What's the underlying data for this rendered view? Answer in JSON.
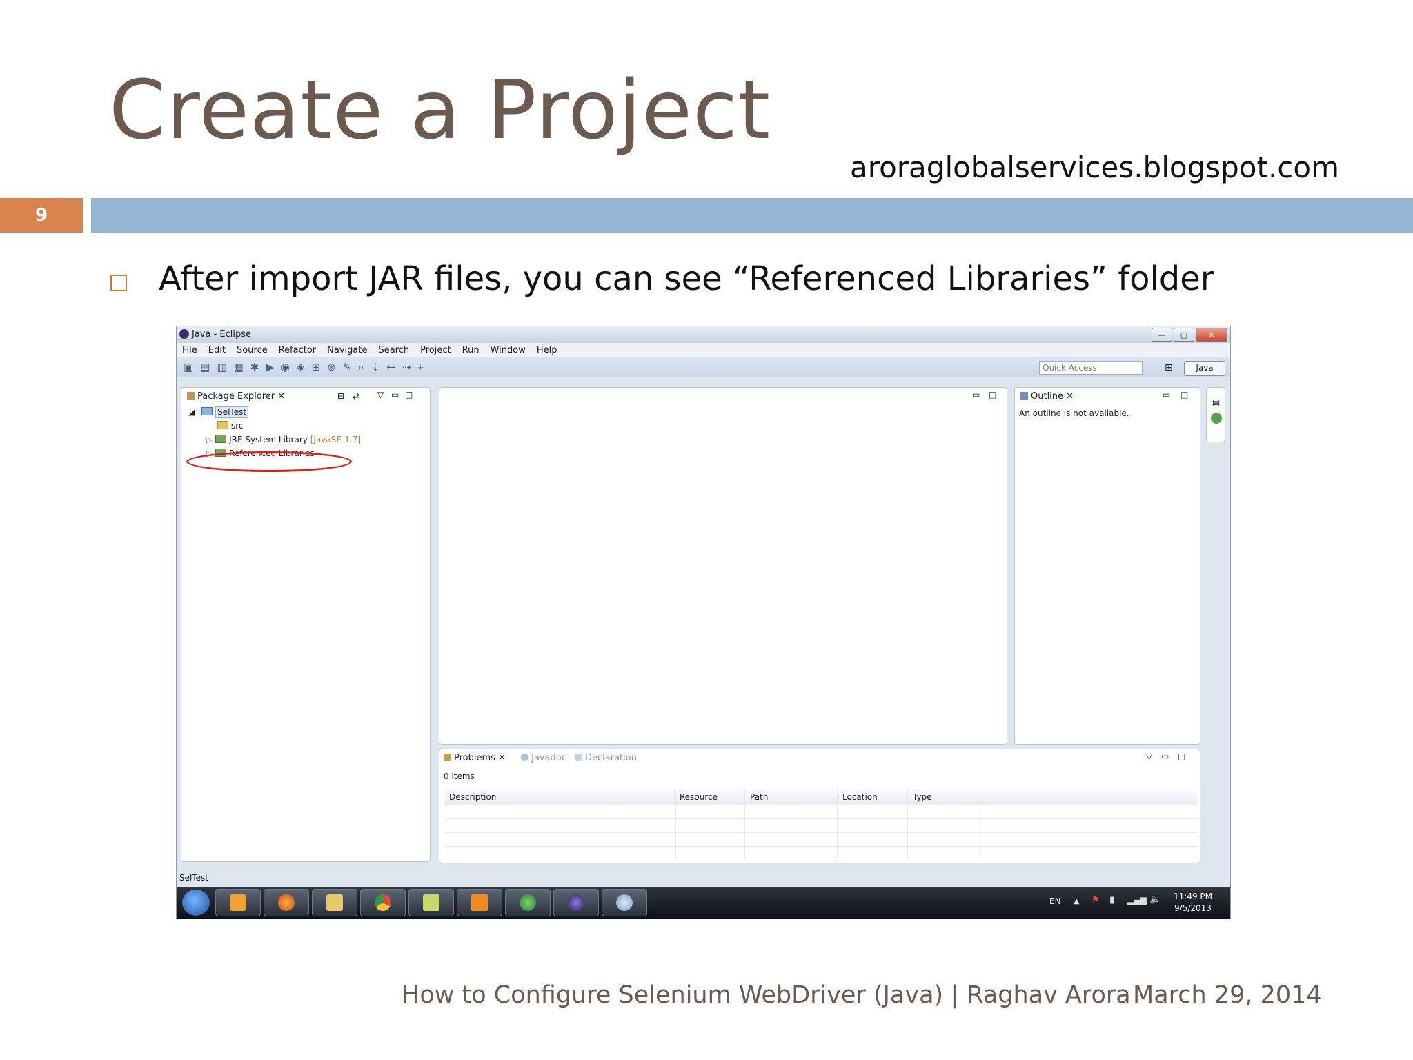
{
  "slide": {
    "title": "Create a Project",
    "site": "aroraglobalservices.blogspot.com",
    "number": "9",
    "bullet": "After import JAR files, you can see “Referenced Libraries” folder",
    "footer_left": "How to Configure Selenium WebDriver (Java) | Raghav Arora",
    "footer_right": "March 29, 2014"
  },
  "colors": {
    "title": "#6b5a4d",
    "band": "#94b6d2",
    "number_box": "#d9824a",
    "highlight": "#d6231d"
  },
  "eclipse": {
    "window_title": "Java - Eclipse",
    "window_controls": [
      "minimize-icon",
      "maximize-icon",
      "close-icon"
    ],
    "menu": [
      "File",
      "Edit",
      "Source",
      "Refactor",
      "Navigate",
      "Search",
      "Project",
      "Run",
      "Window",
      "Help"
    ],
    "quick_access_placeholder": "Quick Access",
    "perspective": "Java",
    "package_explorer": {
      "tab": "Package Explorer",
      "project": "SelTest",
      "items": [
        {
          "label": "src",
          "icon": "source-folder-icon"
        },
        {
          "label": "JRE System Library",
          "suffix": "[JavaSE-1.7]",
          "icon": "library-icon"
        },
        {
          "label": "Referenced Libraries",
          "icon": "library-icon",
          "highlighted": true
        }
      ]
    },
    "outline": {
      "tab": "Outline",
      "message": "An outline is not available."
    },
    "problems": {
      "tabs": [
        "Problems",
        "Javadoc",
        "Declaration"
      ],
      "count": "0 items",
      "columns": [
        "Description",
        "Resource",
        "Path",
        "Location",
        "Type"
      ]
    },
    "status_text": "SelTest",
    "taskbar": {
      "language": "EN",
      "time": "11:49 PM",
      "date": "9/5/2013",
      "apps": [
        "media-player-icon",
        "firefox-icon",
        "file-explorer-icon",
        "chrome-icon",
        "notes-icon",
        "vlc-icon",
        "network-icon",
        "eclipse-icon",
        "paint-icon"
      ]
    }
  }
}
